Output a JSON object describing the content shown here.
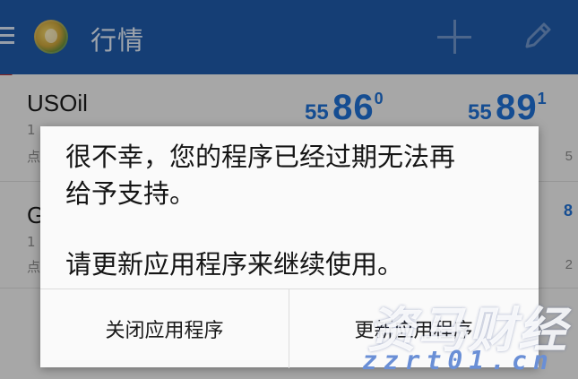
{
  "appbar": {
    "title": "行情",
    "icons": [
      "menu-icon",
      "app-logo",
      "add-icon",
      "edit-icon"
    ]
  },
  "quotes": [
    {
      "symbol": "USOil",
      "sub_line1": "1",
      "sub_line2": "点",
      "bid": {
        "small": "55",
        "big": "86",
        "sup": "0"
      },
      "ask": {
        "small": "55",
        "big": "89",
        "sup": "1"
      },
      "right_text": "5"
    },
    {
      "symbol": "G",
      "sub_line1": "1",
      "sub_line2": "点",
      "right_text_top": "8",
      "right_text": "2"
    }
  ],
  "dialog": {
    "message_line1": "很不幸，您的程序已经过期无法再",
    "message_line2": "给予支持。",
    "message_line3": "请更新应用程序来继续使用。",
    "close_button": "关闭应用程序",
    "update_button": "更新应用程序"
  },
  "watermark": {
    "text": "资马财经",
    "url": "zzrt01.cn"
  },
  "colors": {
    "appbar": "#1f5aa8",
    "price_blue": "#1f6fd1",
    "dialog_bg": "#fafafa"
  }
}
